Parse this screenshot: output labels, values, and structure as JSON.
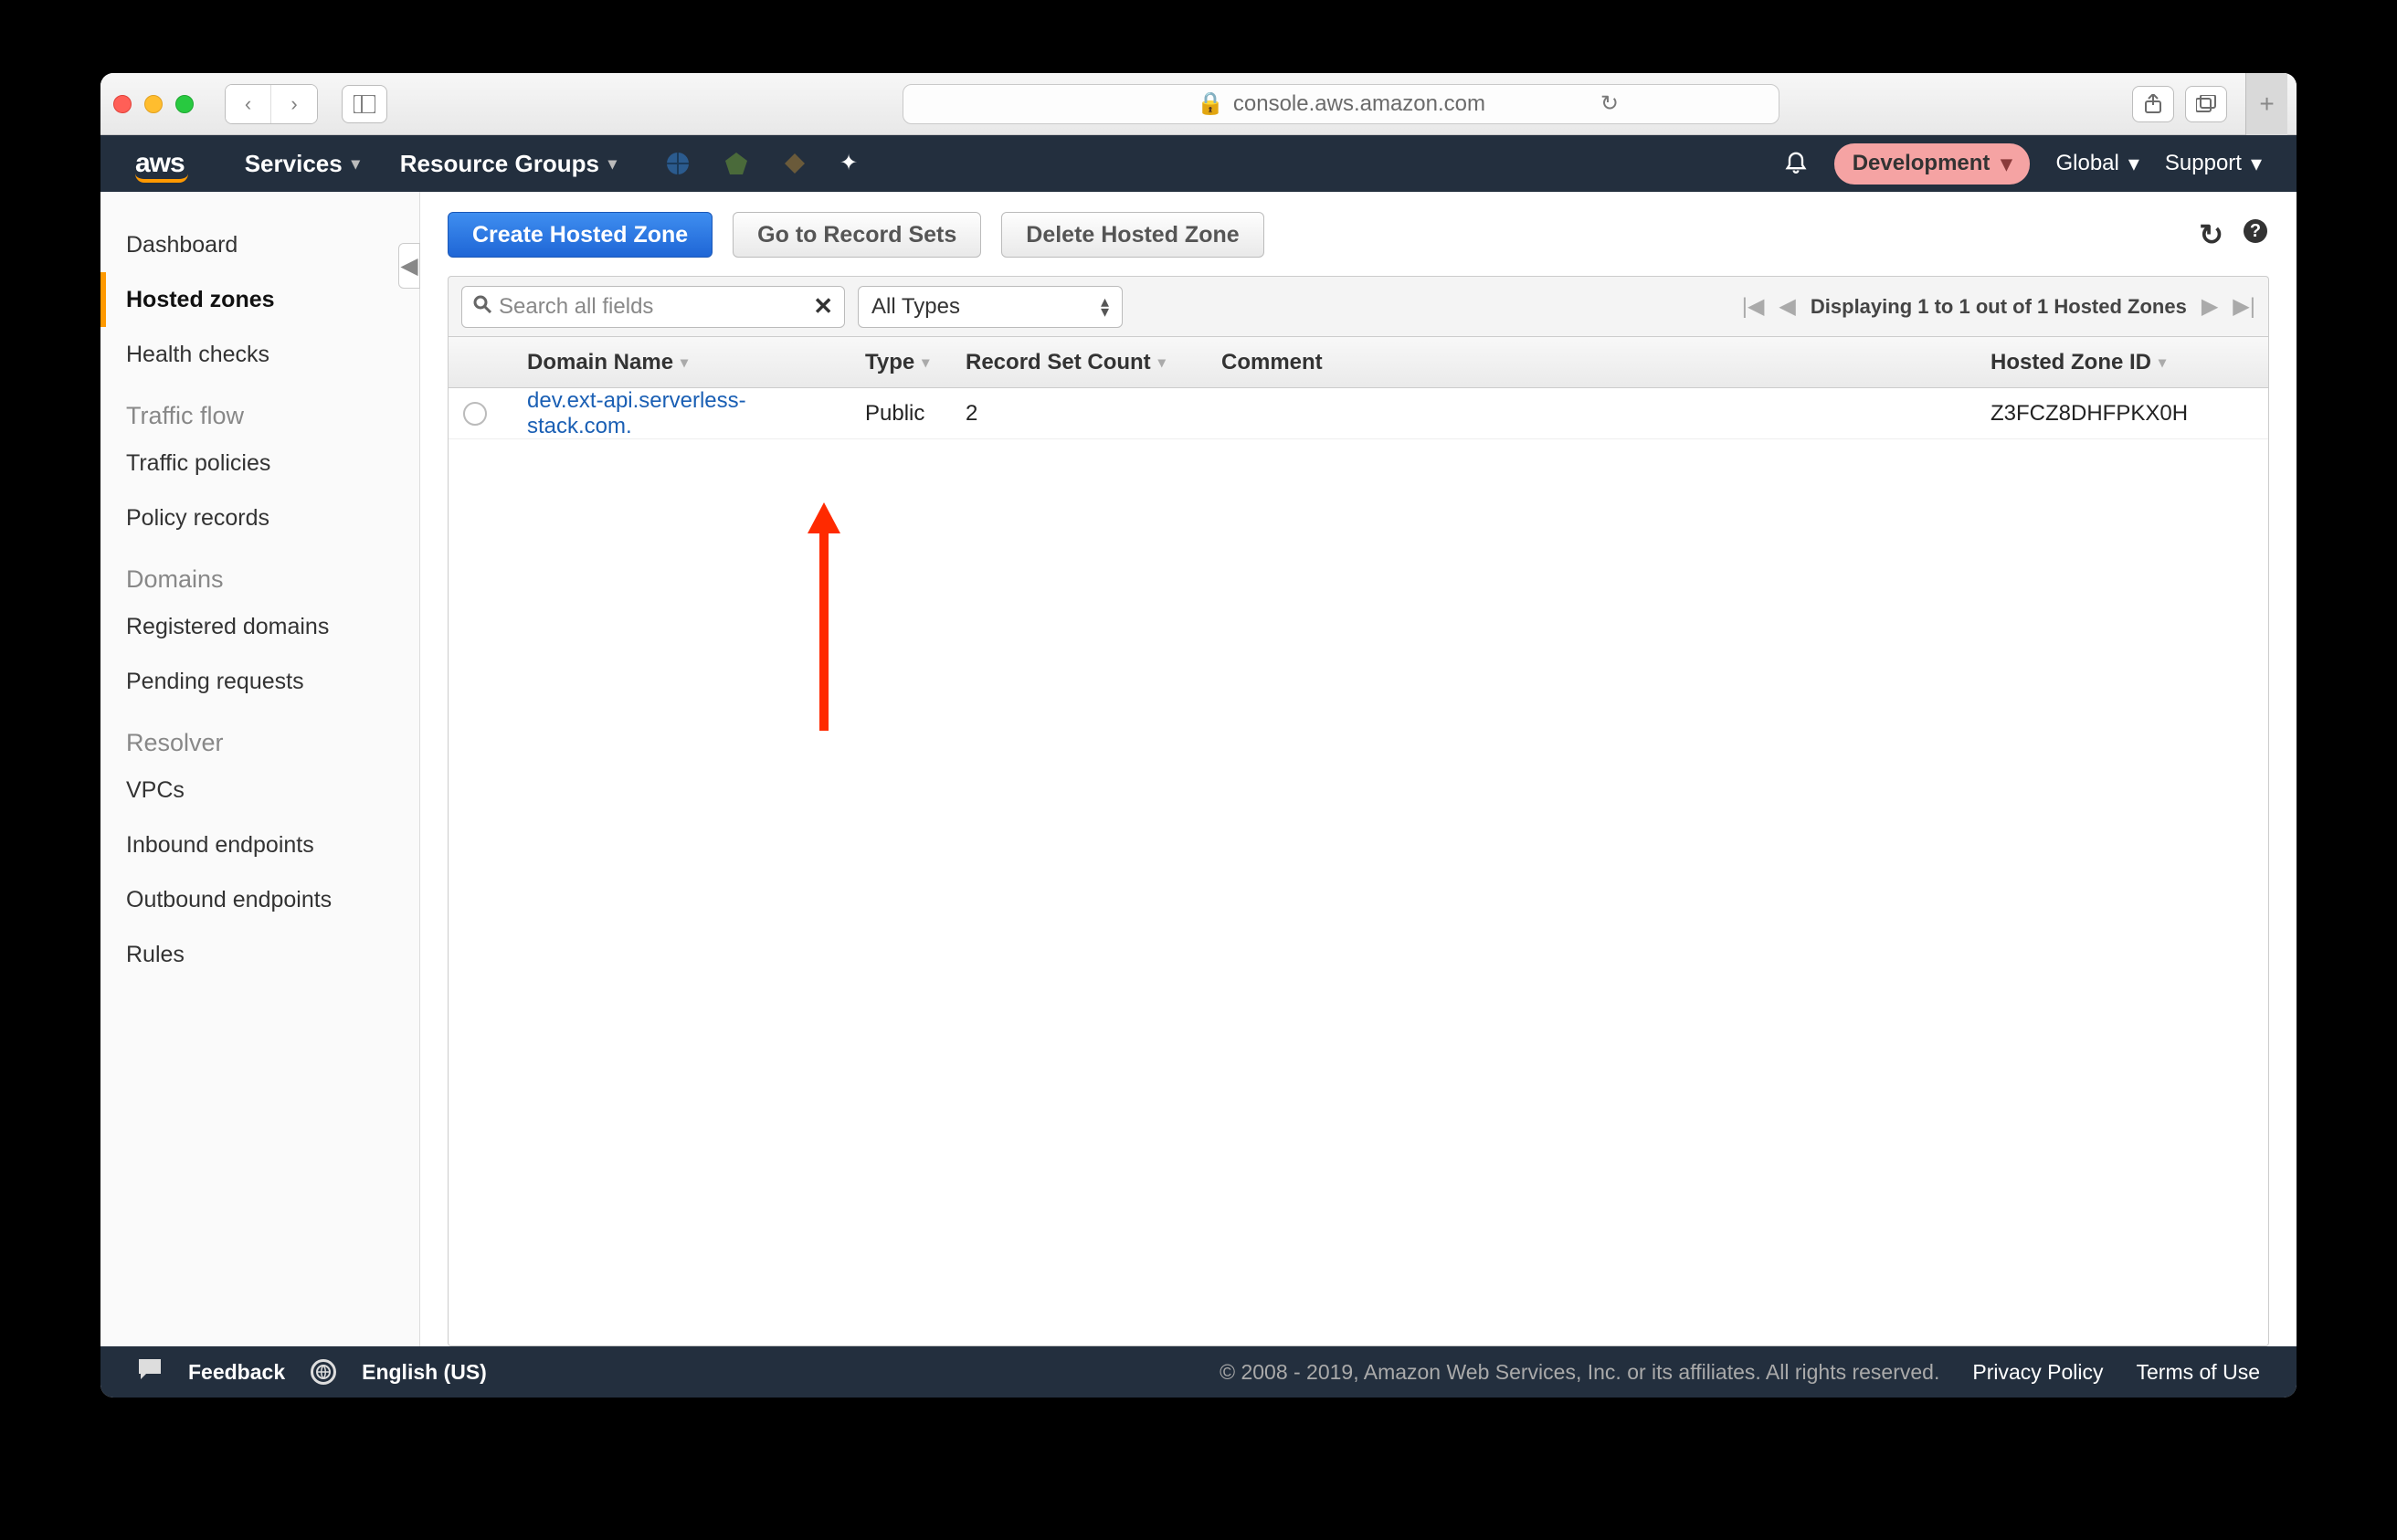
{
  "browser": {
    "url_display": "console.aws.amazon.com",
    "lock_icon": "🔒"
  },
  "nav": {
    "logo": "aws",
    "services": "Services",
    "resource_groups": "Resource Groups",
    "env_label": "Development",
    "region": "Global",
    "support": "Support"
  },
  "sidebar": {
    "items": [
      {
        "label": "Dashboard"
      },
      {
        "label": "Hosted zones"
      },
      {
        "label": "Health checks"
      }
    ],
    "traffic_flow": {
      "title": "Traffic flow",
      "items": [
        {
          "label": "Traffic policies"
        },
        {
          "label": "Policy records"
        }
      ]
    },
    "domains": {
      "title": "Domains",
      "items": [
        {
          "label": "Registered domains"
        },
        {
          "label": "Pending requests"
        }
      ]
    },
    "resolver": {
      "title": "Resolver",
      "items": [
        {
          "label": "VPCs"
        },
        {
          "label": "Inbound endpoints"
        },
        {
          "label": "Outbound endpoints"
        },
        {
          "label": "Rules"
        }
      ]
    }
  },
  "actions": {
    "create": "Create Hosted Zone",
    "goto": "Go to Record Sets",
    "delete": "Delete Hosted Zone"
  },
  "filter": {
    "search_placeholder": "Search all fields",
    "type_select": "All Types",
    "pager_text": "Displaying 1 to 1 out of 1 Hosted Zones"
  },
  "table": {
    "headers": {
      "domain": "Domain Name",
      "type": "Type",
      "rsc": "Record Set Count",
      "comment": "Comment",
      "zone": "Hosted Zone ID"
    },
    "rows": [
      {
        "domain": "dev.ext-api.serverless-stack.com.",
        "type": "Public",
        "rsc": "2",
        "comment": "",
        "zone": "Z3FCZ8DHFPKX0H"
      }
    ]
  },
  "footer": {
    "feedback": "Feedback",
    "language": "English (US)",
    "copyright": "© 2008 - 2019, Amazon Web Services, Inc. or its affiliates. All rights reserved.",
    "privacy": "Privacy Policy",
    "terms": "Terms of Use"
  }
}
